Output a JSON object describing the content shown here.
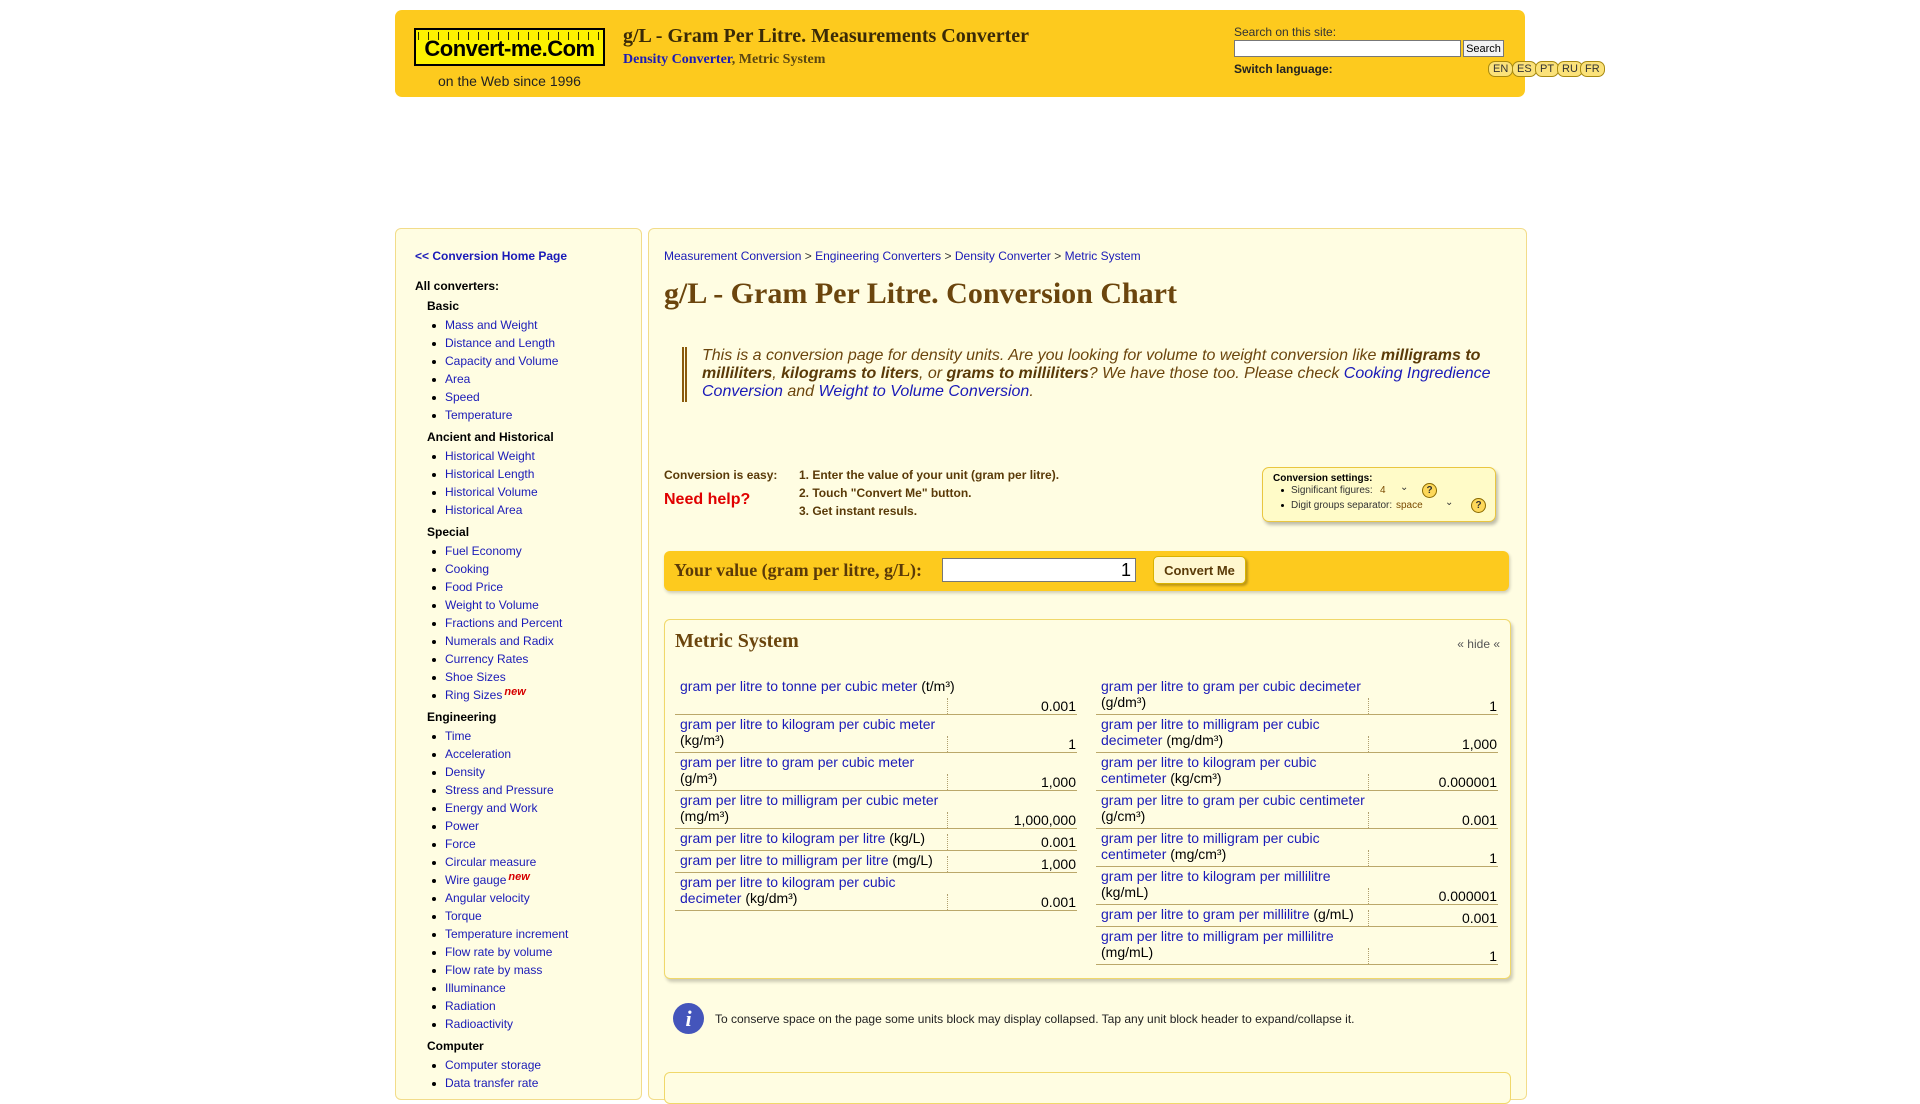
{
  "header": {
    "logo_name": "Convert-me.Com",
    "logo_since": "on the Web since 1996",
    "title": "g/L - Gram Per Litre. Measurements Converter",
    "sub_link": "Density Converter",
    "sub_text": ", Metric System",
    "search_label": "Search on this site:",
    "search_value": "",
    "search_button": "Search",
    "lang_label": "Switch language:",
    "languages": [
      "EN",
      "ES",
      "PT",
      "RU",
      "FR"
    ]
  },
  "sidebar": {
    "home_link": "<< Conversion Home Page",
    "all_label": "All converters:",
    "new_badge": "new",
    "groups": [
      {
        "title": "Basic",
        "items": [
          "Mass and Weight",
          "Distance and Length",
          "Capacity and Volume",
          "Area",
          "Speed",
          "Temperature"
        ]
      },
      {
        "title": "Ancient and Historical",
        "items": [
          "Historical Weight",
          "Historical Length",
          "Historical Volume",
          "Historical Area"
        ]
      },
      {
        "title": "Special",
        "items": [
          "Fuel Economy",
          "Cooking",
          "Food Price",
          "Weight to Volume",
          "Fractions and Percent",
          "Numerals and Radix",
          "Currency Rates",
          "Shoe Sizes",
          "Ring Sizes"
        ]
      },
      {
        "title": "Engineering",
        "items": [
          "Time",
          "Acceleration",
          "Density",
          "Stress and Pressure",
          "Energy and Work",
          "Power",
          "Force",
          "Circular measure",
          "Wire gauge",
          "Angular velocity",
          "Torque",
          "Temperature increment",
          "Flow rate by volume",
          "Flow rate by mass",
          "Illuminance",
          "Radiation",
          "Radioactivity"
        ]
      },
      {
        "title": "Computer",
        "items": [
          "Computer storage",
          "Data transfer rate"
        ]
      }
    ]
  },
  "breadcrumbs": [
    "Measurement Conversion",
    "Engineering Converters",
    "Density Converter",
    "Metric System"
  ],
  "breadcrumb_sep": " > ",
  "page_title": "g/L - Gram Per Litre. Conversion Chart",
  "intro": {
    "t1": "This is a conversion page for density units. Are you looking for volume to weight conversion like ",
    "b1": "milligrams to milliliters",
    "t2": ", ",
    "b2": "kilograms to liters",
    "t3": ", or ",
    "b3": "grams to milliliters",
    "t4": "? We have those too. Please check ",
    "l1": "Cooking Ingredience Conversion",
    "t5": " and ",
    "l2": "Weight to Volume Conversion",
    "t6": "."
  },
  "instructions": {
    "easy": "Conversion is easy:",
    "help": "Need help?",
    "steps": [
      "1. Enter the value of your unit (gram per litre).",
      "2. Touch \"Convert Me\" button.",
      "3. Get instant resuls."
    ]
  },
  "settings": {
    "title": "Conversion settings:",
    "sig_label": "Significant figures:",
    "sig_value": "4",
    "sep_label": "Digit groups separator:",
    "sep_value": "space",
    "help": "?",
    "chevron": "⌄"
  },
  "value_bar": {
    "label": "Your value (gram per litre, g/L):",
    "value": "1",
    "button": "Convert Me"
  },
  "metric": {
    "title": "Metric System",
    "hide": "« hide «",
    "left": [
      {
        "link": "gram per litre to tonne per cubic meter",
        "unit": "(t/m³)",
        "value": "0.001"
      },
      {
        "link": "gram per litre to kilogram per cubic meter",
        "unit": "(kg/m³)",
        "value": "1"
      },
      {
        "link": "gram per litre to gram per cubic meter",
        "unit": "(g/m³)",
        "value": "1,000"
      },
      {
        "link": "gram per litre to milligram per cubic meter",
        "unit": "(mg/m³)",
        "value": "1,000,000"
      },
      {
        "link": "gram per litre to kilogram per litre",
        "unit": "(kg/L)",
        "value": "0.001"
      },
      {
        "link": "gram per litre to milligram per litre",
        "unit": "(mg/L)",
        "value": "1,000"
      },
      {
        "link": "gram per litre to kilogram per cubic decimeter",
        "unit": "(kg/dm³)",
        "value": "0.001"
      }
    ],
    "right": [
      {
        "link": "gram per litre to gram per cubic decimeter",
        "unit": "(g/dm³)",
        "value": "1"
      },
      {
        "link": "gram per litre to milligram per cubic decimeter",
        "unit": "(mg/dm³)",
        "value": "1,000"
      },
      {
        "link": "gram per litre to kilogram per cubic centimeter",
        "unit": "(kg/cm³)",
        "value": "0.000001"
      },
      {
        "link": "gram per litre to gram per cubic centimeter",
        "unit": "(g/cm³)",
        "value": "0.001"
      },
      {
        "link": "gram per litre to milligram per cubic centimeter",
        "unit": "(mg/cm³)",
        "value": "1"
      },
      {
        "link": "gram per litre to kilogram per millilitre",
        "unit": "(kg/mL)",
        "value": "0.000001"
      },
      {
        "link": "gram per litre to gram per millilitre",
        "unit": "(g/mL)",
        "value": "0.001"
      },
      {
        "link": "gram per litre to milligram per millilitre",
        "unit": "(mg/mL)",
        "value": "1"
      }
    ]
  },
  "info": {
    "icon": "i",
    "text": "To conserve space on the page some units block may display collapsed. Tap any unit block header to expand/collapse it."
  }
}
